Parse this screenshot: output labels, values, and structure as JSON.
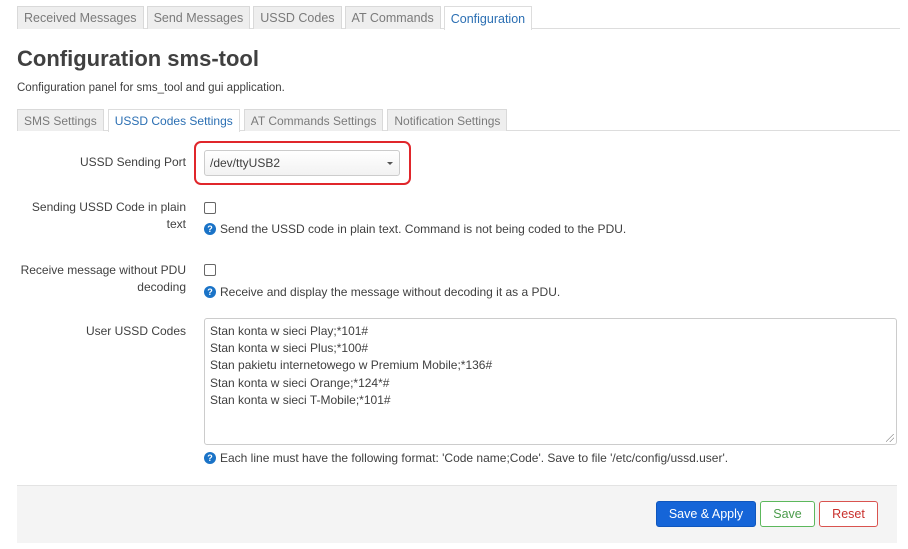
{
  "top_tabs": [
    {
      "label": "Received Messages",
      "active": false
    },
    {
      "label": "Send Messages",
      "active": false
    },
    {
      "label": "USSD Codes",
      "active": false
    },
    {
      "label": "AT Commands",
      "active": false
    },
    {
      "label": "Configuration",
      "active": true
    }
  ],
  "page": {
    "title": "Configuration sms-tool",
    "subtitle": "Configuration panel for sms_tool and gui application."
  },
  "sub_tabs": [
    {
      "label": "SMS Settings",
      "active": false
    },
    {
      "label": "USSD Codes Settings",
      "active": true
    },
    {
      "label": "AT Commands Settings",
      "active": false
    },
    {
      "label": "Notification Settings",
      "active": false
    }
  ],
  "form": {
    "port_label": "USSD Sending Port",
    "port_value": "/dev/ttyUSB2",
    "plain_label_1": "Sending USSD Code in plain",
    "plain_label_2": "text",
    "plain_hint": "Send the USSD code in plain text. Command is not being coded to the PDU.",
    "pdu_label_1": "Receive message without PDU",
    "pdu_label_2": "decoding",
    "pdu_hint": "Receive and display the message without decoding it as a PDU.",
    "codes_label": "User USSD Codes",
    "codes_lines": [
      "Stan konta w sieci Play;*101#",
      "Stan konta w sieci Plus;*100#",
      "Stan pakietu internetowego w Premium Mobile;*136#",
      "Stan konta w sieci Orange;*124*#",
      "Stan konta w sieci T-Mobile;*101#"
    ],
    "codes_hint": "Each line must have the following format: 'Code name;Code'. Save to file '/etc/config/ussd.user'."
  },
  "buttons": {
    "save_apply": "Save & Apply",
    "save": "Save",
    "reset": "Reset"
  },
  "colors": {
    "accent": "#1565d8",
    "highlight": "#e0262b",
    "active_tab": "#2b6fb3"
  }
}
